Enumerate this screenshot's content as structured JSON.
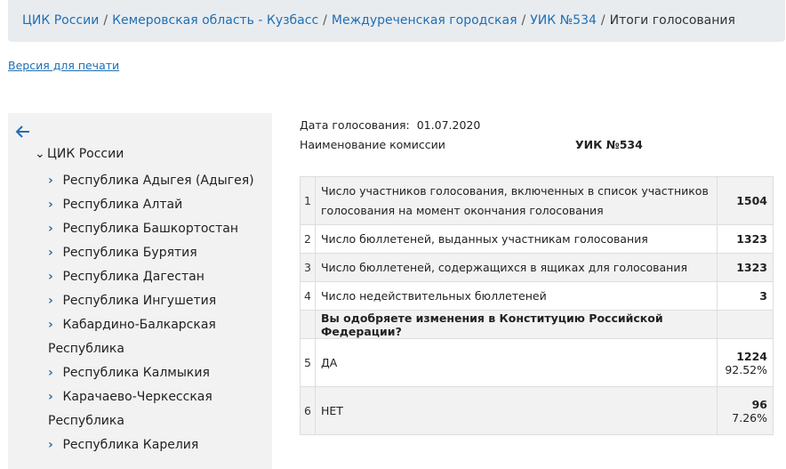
{
  "breadcrumb": {
    "items": [
      "ЦИК России",
      "Кемеровская область - Кузбасс",
      "Междуреченская городская",
      "УИК №534"
    ],
    "current": "Итоги голосования",
    "separator": "/"
  },
  "print_link": "Версия для печати",
  "sidebar": {
    "root": "ЦИК России",
    "items": [
      "Республика Адыгея (Адыгея)",
      "Республика Алтай",
      "Республика Башкортостан",
      "Республика Бурятия",
      "Республика Дагестан",
      "Республика Ингушетия",
      "Кабардино-Балкарская Республика",
      "Республика Калмыкия",
      "Карачаево-Черкесская Республика",
      "Республика Карелия"
    ]
  },
  "info": {
    "date_label": "Дата голосования:",
    "date_value": "01.07.2020",
    "commission_label": "Наименование комиссии",
    "commission_value": "УИК №534"
  },
  "results": {
    "rows": [
      {
        "num": "1",
        "label": "Число участников голосования, включенных в список участников голосования на момент окончания голосования",
        "value": "1504"
      },
      {
        "num": "2",
        "label": "Число бюллетеней, выданных участникам голосования",
        "value": "1323"
      },
      {
        "num": "3",
        "label": "Число бюллетеней, содержащихся в ящиках для голосования",
        "value": "1323"
      },
      {
        "num": "4",
        "label": "Число недействительных бюллетеней",
        "value": "3"
      }
    ],
    "question": "Вы одобряете изменения в Конституцию Российской Федерации?",
    "answers": [
      {
        "num": "5",
        "label": "ДА",
        "value": "1224",
        "percent": "92.52%"
      },
      {
        "num": "6",
        "label": "НЕТ",
        "value": "96",
        "percent": "7.26%"
      }
    ]
  },
  "colors": {
    "link": "#1f6fb5",
    "breadcrumb_bg": "#e9ecef",
    "sidebar_bg": "#f2f2f2"
  }
}
